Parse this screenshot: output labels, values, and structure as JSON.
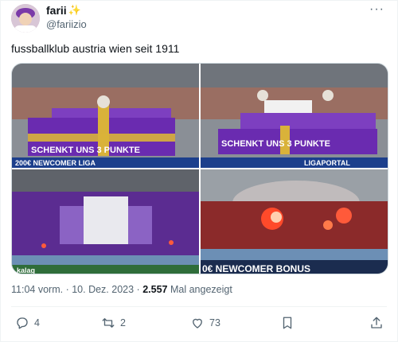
{
  "author": {
    "name": "farii",
    "badge": "✨",
    "handle": "@fariizio"
  },
  "tweet": {
    "text": "fussballklub austria wien seit 1911"
  },
  "media": {
    "banner_text": "SCHENKT UNS 3 PUNKTE",
    "ad_board_1": "200€ NEWCOMER LIGA",
    "ad_board_2": "LIGAPORTAL",
    "ad_board_3": "0€ NEWCOMER BONUS",
    "sponsor": "kalag"
  },
  "meta": {
    "time": "11:04 vorm.",
    "sep": "·",
    "date": "10. Dez. 2023",
    "views_count": "2.557",
    "views_label": "Mal angezeigt"
  },
  "actions": {
    "replies": "4",
    "retweets": "2",
    "likes": "73"
  },
  "colors": {
    "purple": "#6a2bb0",
    "text_secondary": "#536471"
  }
}
